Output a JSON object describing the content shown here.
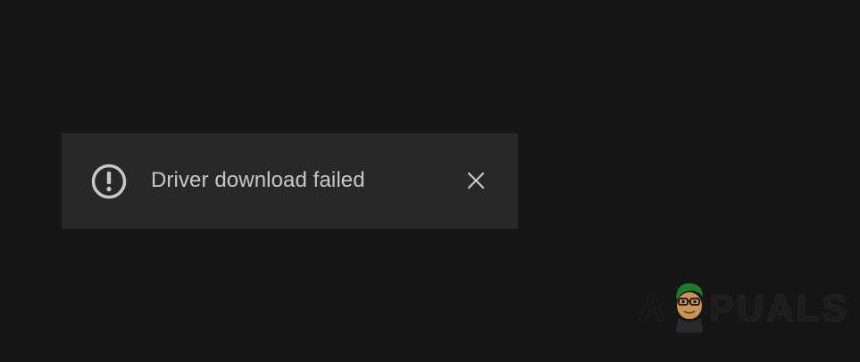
{
  "toast": {
    "icon": "exclamation-circle-icon",
    "message": "Driver download failed",
    "close_icon": "close-icon"
  },
  "watermark": {
    "text_before": "A",
    "text_after": "PUALS",
    "mascot": "appuals-mascot-logo"
  },
  "colors": {
    "background": "#161616",
    "toast_background": "#282828",
    "toast_text": "#c8c8c8",
    "icon": "#c8c8c8"
  }
}
